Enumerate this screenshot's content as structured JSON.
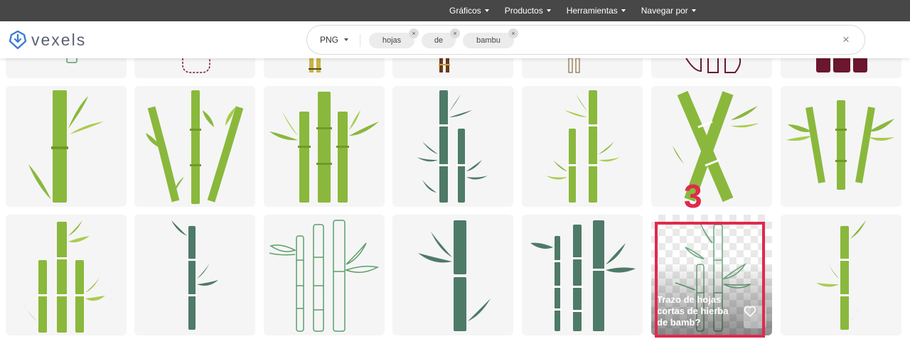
{
  "topnav": {
    "items": [
      {
        "label": "Gráficos"
      },
      {
        "label": "Productos"
      },
      {
        "label": "Herramientas"
      },
      {
        "label": "Navegar por"
      }
    ]
  },
  "header": {
    "logo_text": "vexels",
    "search": {
      "format": "PNG",
      "chips": [
        {
          "label": "hojas",
          "remove": "×"
        },
        {
          "label": "de",
          "remove": "×"
        },
        {
          "label": "bambu",
          "remove": "×"
        }
      ],
      "clear": "×"
    }
  },
  "results": {
    "hovered_title": "Trazo de hojas cortas de hierba de bamb?"
  },
  "annotation": {
    "number": "3"
  },
  "colors": {
    "green": "#8ab83c",
    "green_light": "#a9cc4d",
    "teal": "#4e7a68",
    "outline_green": "#5c9e6a",
    "maroon": "#6b1730",
    "highlight": "#e0294d",
    "topbar": "#474747"
  }
}
